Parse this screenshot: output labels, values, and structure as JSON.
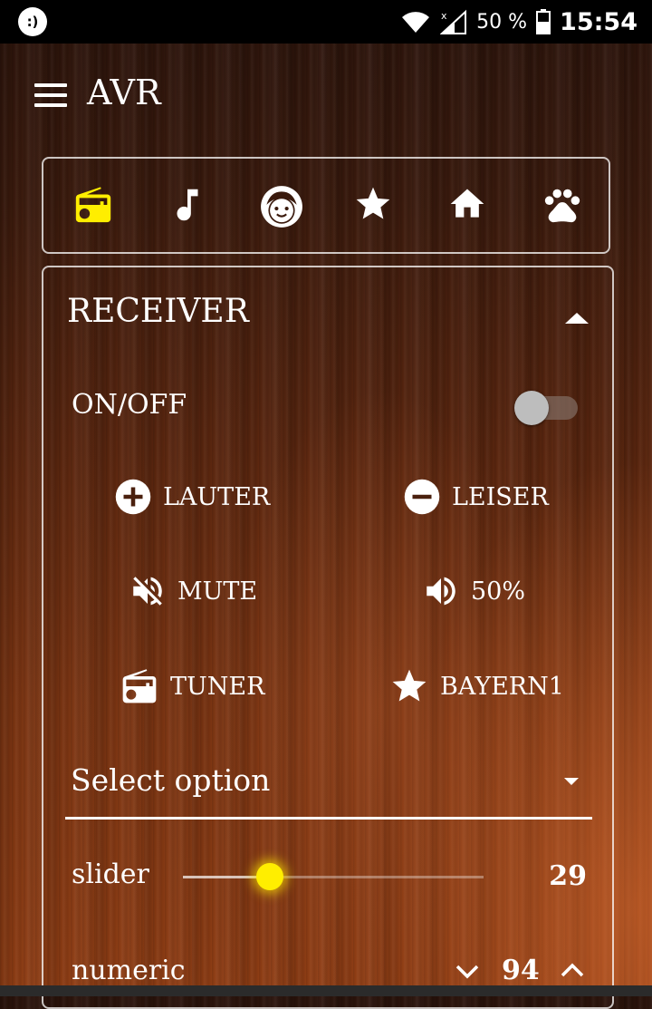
{
  "status_bar": {
    "battery_text": "50 %",
    "time": "15:54",
    "icons": [
      "chat-icon",
      "wifi-icon",
      "signal-icon",
      "battery-icon"
    ]
  },
  "app_bar": {
    "title": "AVR",
    "menu_icon": "hamburger-menu-icon"
  },
  "tabs": [
    {
      "icon": "radio-icon",
      "active": true
    },
    {
      "icon": "music-note-icon",
      "active": false
    },
    {
      "icon": "face-icon",
      "active": false
    },
    {
      "icon": "star-icon",
      "active": false
    },
    {
      "icon": "home-icon",
      "active": false
    },
    {
      "icon": "paw-icon",
      "active": false
    }
  ],
  "receiver": {
    "title": "RECEIVER",
    "power_label": "ON/OFF",
    "power_on": false,
    "buttons": {
      "louder": "LAUTER",
      "quieter": "LEISER",
      "mute": "MUTE",
      "volume": "50%",
      "tuner": "TUNER",
      "station": "BAYERN1"
    },
    "select": {
      "value": "Select option"
    },
    "slider": {
      "label": "slider",
      "value": "29",
      "fraction": 0.29
    },
    "numeric": {
      "label": "numeric",
      "value": "94"
    }
  },
  "colors": {
    "accent": "#ffee00",
    "active_tab": "#ffee00",
    "text": "#ffffff"
  }
}
